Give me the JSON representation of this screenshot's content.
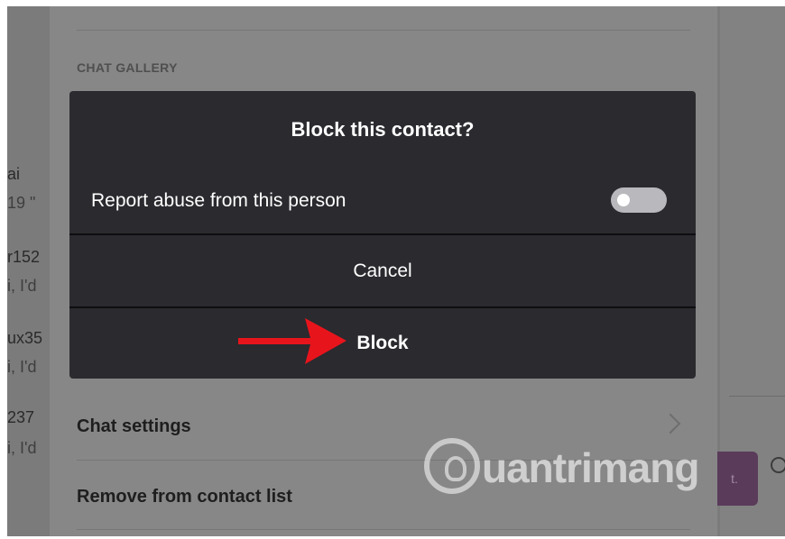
{
  "background_list": {
    "items": [
      {
        "name": "ai",
        "preview": "19 \""
      },
      {
        "name": "r152",
        "preview": "i, I'd"
      },
      {
        "name": "ux35",
        "preview": "i, I'd"
      },
      {
        "name": "237",
        "preview": "i, I'd"
      }
    ]
  },
  "panel": {
    "section_header": "CHAT GALLERY",
    "chat_settings_label": "Chat settings",
    "remove_contact_label": "Remove from contact list"
  },
  "dialog": {
    "title": "Block this contact?",
    "report_label": "Report abuse from this person",
    "report_enabled": false,
    "cancel_label": "Cancel",
    "block_label": "Block"
  },
  "composer": {
    "send_label": "t."
  },
  "watermark": {
    "text": "uantrimang"
  },
  "colors": {
    "dialog_bg": "#2a2a2f",
    "overlay": "#878787",
    "arrow": "#e8141c"
  }
}
